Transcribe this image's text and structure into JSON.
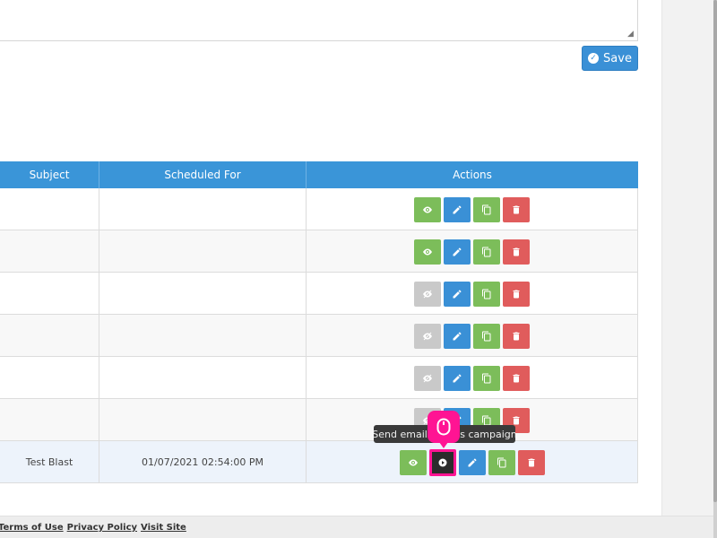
{
  "save_button": {
    "label": "Save",
    "icon": "check-circle-icon"
  },
  "table": {
    "headers": {
      "subject": "Subject",
      "scheduled": "Scheduled For",
      "actions": "Actions"
    },
    "rows": [
      {
        "subject": "",
        "scheduled": ""
      },
      {
        "subject": "",
        "scheduled": ""
      },
      {
        "subject": "",
        "scheduled": ""
      },
      {
        "subject": "",
        "scheduled": ""
      },
      {
        "subject": "",
        "scheduled": ""
      },
      {
        "subject": "",
        "scheduled": ""
      },
      {
        "subject": "Test Blast",
        "scheduled": "01/07/2021 02:54:00 PM"
      }
    ]
  },
  "tooltip": {
    "text": "Send email for this campaign"
  },
  "footer": {
    "terms": "Terms of Use",
    "privacy": "Privacy Policy",
    "visit": "Visit Site"
  },
  "colors": {
    "header_blue": "#3a95d8",
    "button_blue": "#3a90d6",
    "button_green": "#7cbd5a",
    "button_red": "#e05c5c",
    "button_gray": "#c9c9c9",
    "cursor_pink": "#ff1493"
  }
}
